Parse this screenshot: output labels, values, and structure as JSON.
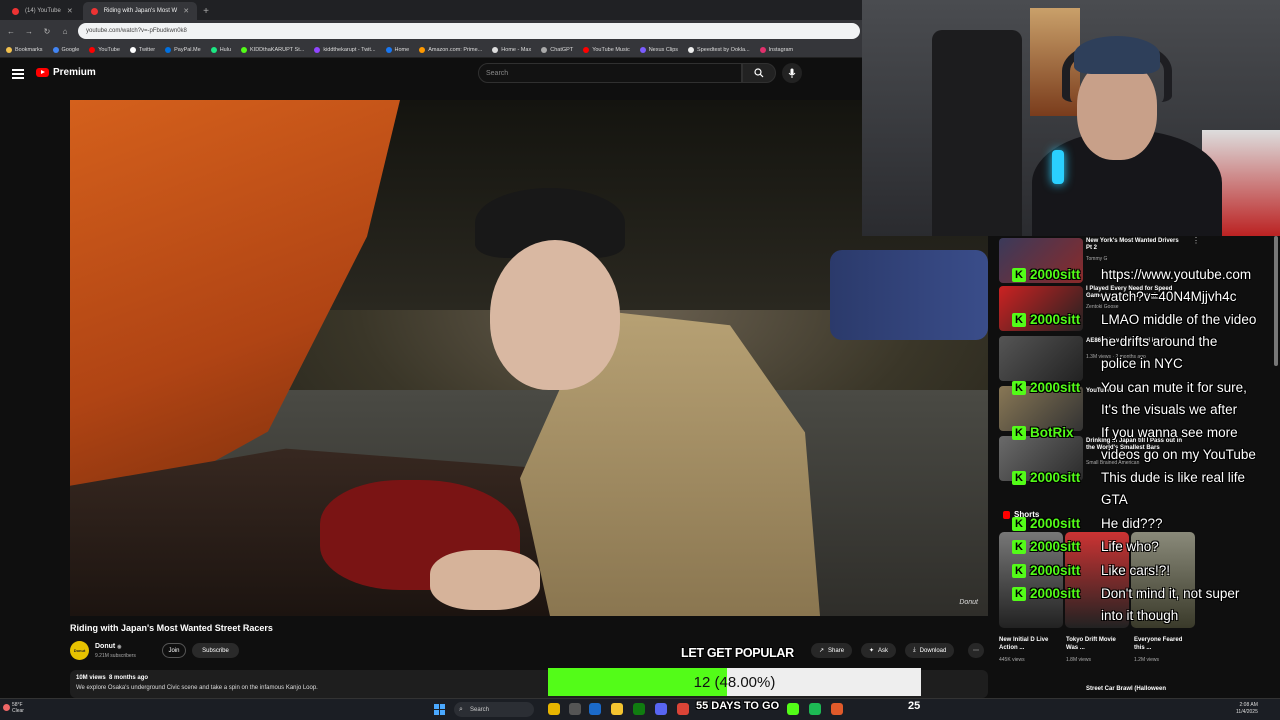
{
  "browser": {
    "tabs": [
      {
        "label": "(14) YouTube"
      },
      {
        "label": "Riding with Japan's Most W"
      }
    ],
    "url": "youtube.com/watch?v=-pFbudkwn0k8",
    "bookmarks": [
      "Bookmarks",
      "Google",
      "YouTube",
      "Twitter",
      "PayPal.Me",
      "Hulu",
      "KIDDthaKARUPT St...",
      "kiddthekarupt - Twit...",
      "Home",
      "Amazon.com: Prime...",
      "Home - Max",
      "ChatGPT",
      "YouTube Music",
      "Nexus Clips",
      "Speedtest by Ookla...",
      "Instagram"
    ]
  },
  "youtube": {
    "logo_text": "Premium",
    "search_placeholder": "Search"
  },
  "video": {
    "title": "Riding with Japan's Most Wanted Street Racers",
    "channel_name": "Donut",
    "subscribers": "9.21M subscribers",
    "join_label": "Join",
    "subscribe_label": "Subscribe",
    "actions": {
      "share": "Share",
      "ask": "Ask",
      "download": "Download"
    },
    "views": "10M views",
    "age": "8 months ago",
    "description": "We explore Osaka's underground Civic scene and take a spin on the infamous Kanjo Loop."
  },
  "sidebar": {
    "recs": [
      {
        "title": "New York's Most Wanted Drivers Pt 2",
        "channel": "Tommy G"
      },
      {
        "title": "I Played Every Need for Speed Game (and ranked them)",
        "channel": "Zentoki Goose"
      },
      {
        "title": "AE86 - How bad Could it be?",
        "meta": "1.3M views · 2 months ago"
      },
      {
        "title": "YouTube Mix"
      },
      {
        "title": "Drinking in Japan till I Pass out in the World's Smallest Bars",
        "channel": "Small Brained American"
      }
    ],
    "shorts_label": "Shorts",
    "shorts": [
      {
        "title": "New Initial D Live Action ...",
        "views": "445K views"
      },
      {
        "title": "Tokyo Drift Movie Was ...",
        "views": "1.8M views"
      },
      {
        "title": "Everyone Feared this ...",
        "views": "1.2M views"
      }
    ],
    "last_rec_title": "Street Car Brawl (Halloween"
  },
  "chat": [
    {
      "user": "2000sitt",
      "lines": [
        "https://www.youtube.com",
        "watch?v=40N4Mjjvh4c"
      ]
    },
    {
      "user": "2000sitt",
      "lines": [
        "LMAO middle of the video",
        "he drifts around the",
        "police in NYC"
      ]
    },
    {
      "user": "2000sitt",
      "lines": [
        "You can mute it for sure,",
        "It's the visuals we after"
      ]
    },
    {
      "user": "BotRix",
      "lines": [
        "If you wanna see more",
        "videos go on my YouTube"
      ]
    },
    {
      "user": "2000sitt",
      "lines": [
        "This dude is like real life",
        "GTA"
      ]
    },
    {
      "user": "2000sitt",
      "lines": [
        "He did???"
      ]
    },
    {
      "user": "2000sitt",
      "lines": [
        "Life who?"
      ]
    },
    {
      "user": "2000sitt",
      "lines": [
        "Like cars!?!"
      ]
    },
    {
      "user": "2000sitt",
      "lines": [
        "Don't mind it, not super",
        "into it though"
      ]
    }
  ],
  "overlay": {
    "goal_label": "LET GET POPULAR",
    "goal_text": "12 (48.00%)",
    "goal_progress": 0.48,
    "days_label": "55 DAYS TO GO",
    "days_count": "25"
  },
  "taskbar": {
    "weather_temp": "58°F",
    "weather_desc": "Clear",
    "search_label": "Search",
    "time": "2:08 AM",
    "date": "11/4/2025"
  },
  "colors": {
    "kick_green": "#53fc18",
    "youtube_red": "#ff0000",
    "background": "#0f0f0f"
  }
}
